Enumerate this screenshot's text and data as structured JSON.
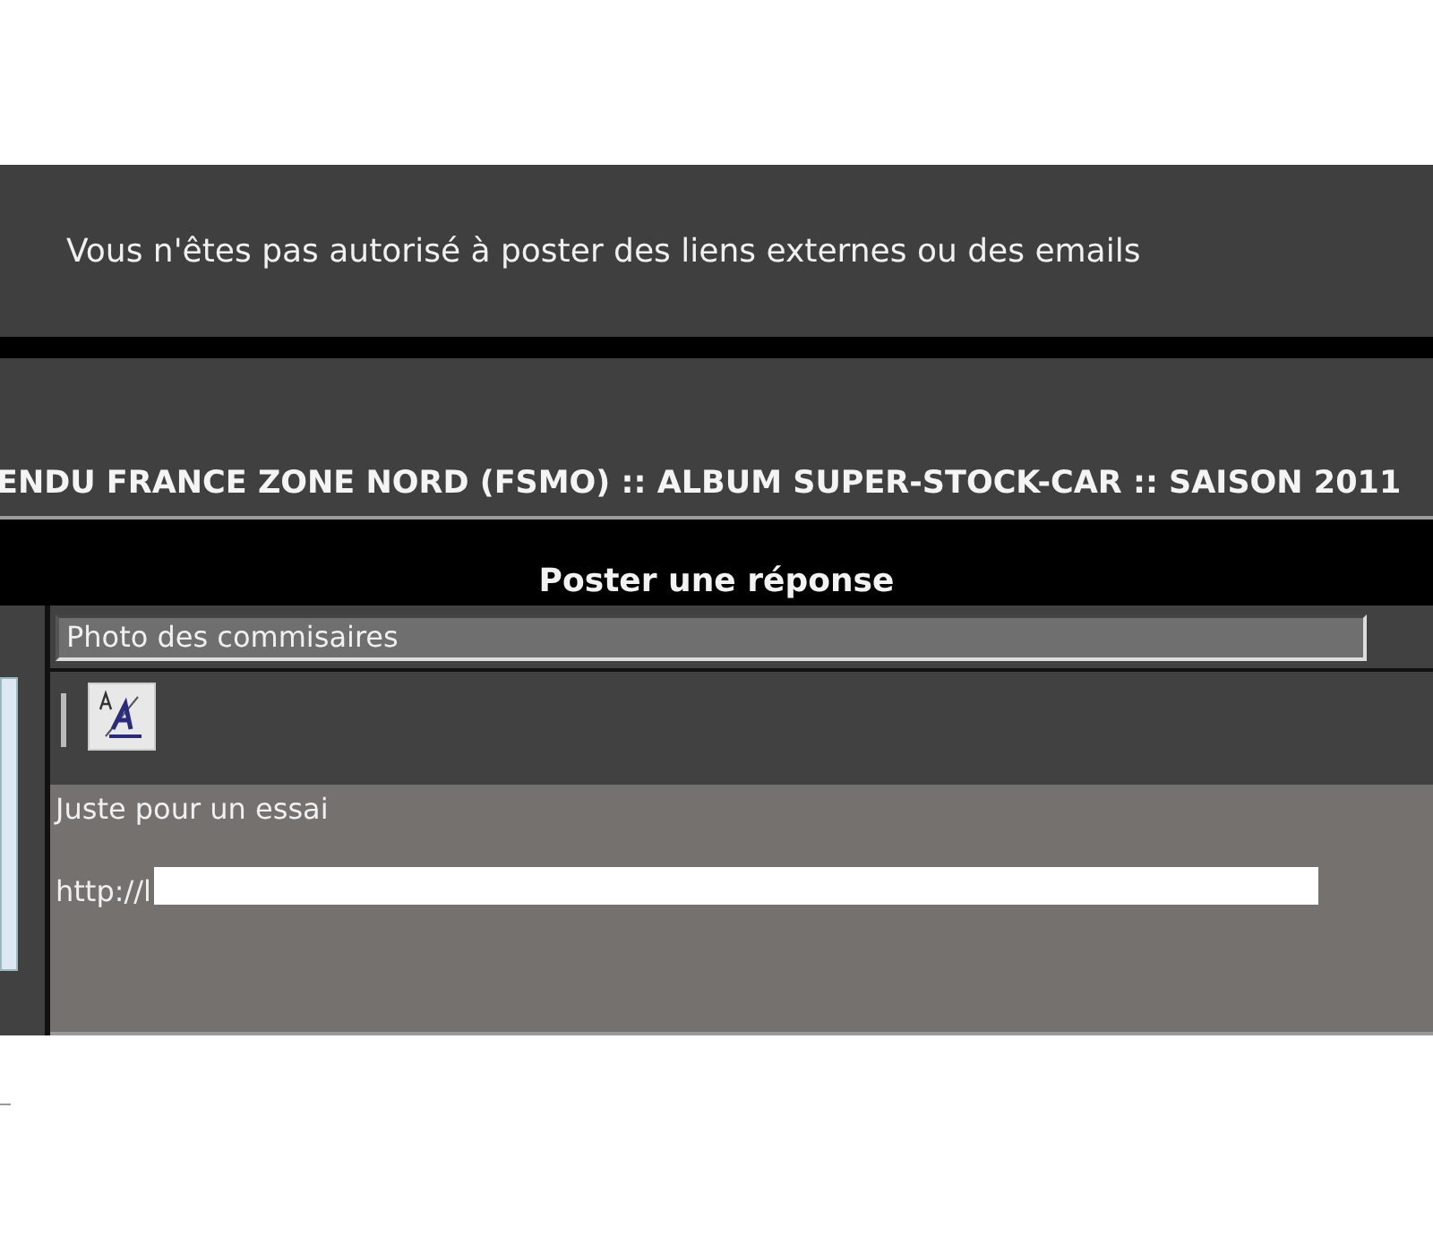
{
  "notice": {
    "text": "Vous n'êtes pas autorisé à poster des liens externes ou des emails"
  },
  "breadcrumb": {
    "text": "ENDU FRANCE ZONE NORD (FSMO) :: ALBUM SUPER-STOCK-CAR :: SAISON 2011"
  },
  "form": {
    "title": "Poster une réponse",
    "subject": {
      "value": "Photo des commisaires"
    },
    "message": {
      "value": "Juste pour un essai\n\nhttp://l",
      "redacted": true
    }
  }
}
